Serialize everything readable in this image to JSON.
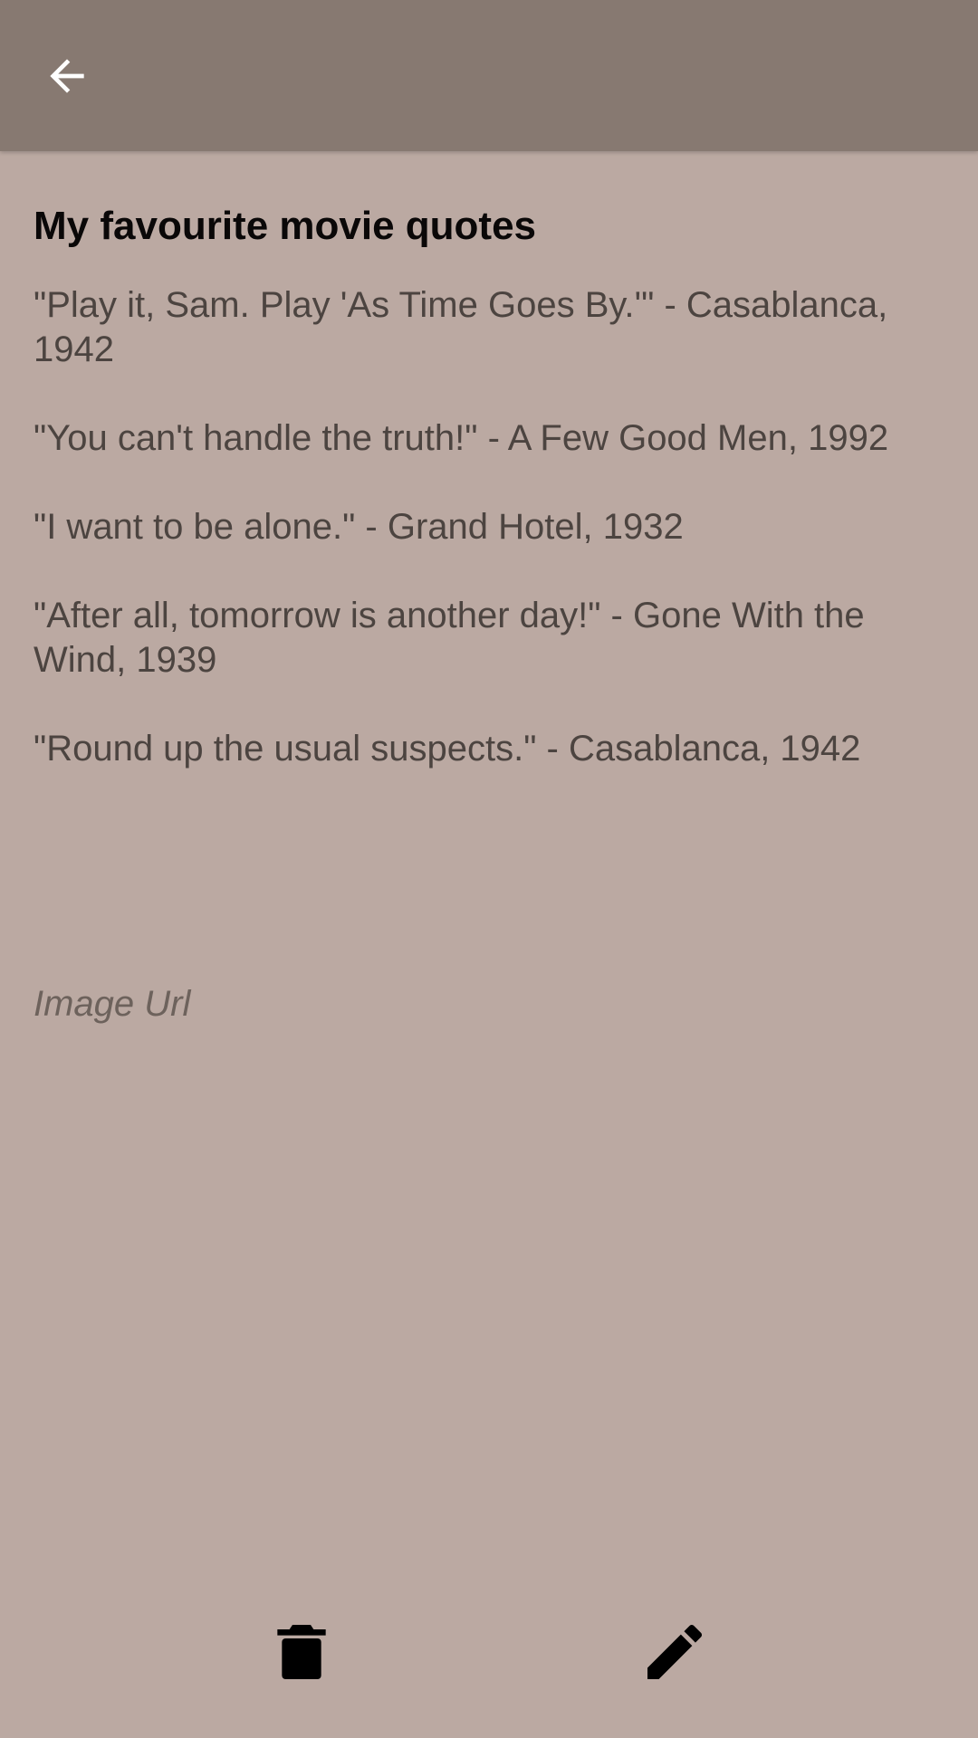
{
  "appbar": {
    "back_icon": "arrow-back-icon",
    "background": "#877971"
  },
  "note": {
    "title": "My favourite movie quotes",
    "body": "\"Play it, Sam. Play 'As Time Goes By.'\" - Casablanca,\n1942\n\n\"You can't handle the truth!\" - A Few Good Men, 1992\n\n\"I want to be alone.\" - Grand Hotel, 1932\n\n\"After all, tomorrow is another day!\" - Gone With the\nWind, 1939\n\n\"Round up the usual suspects.\" - Casablanca, 1942"
  },
  "image_url": {
    "placeholder": "Image Url"
  },
  "actions": {
    "delete_icon": "trash-icon",
    "edit_icon": "pencil-icon"
  },
  "colors": {
    "background": "#bba9a2",
    "body_text": "#4c4440",
    "title_text": "#0a0808"
  }
}
